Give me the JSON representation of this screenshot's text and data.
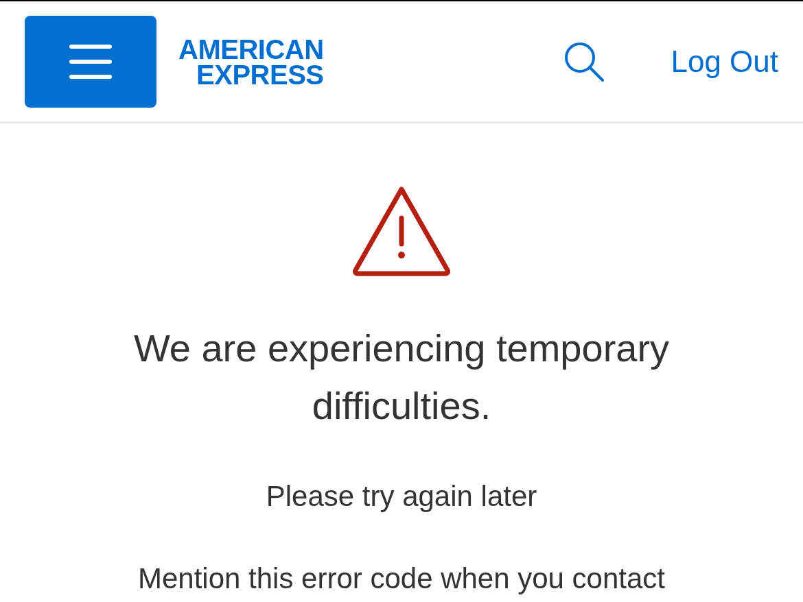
{
  "header": {
    "logo": [
      "AMERICAN",
      "EXPRESS"
    ],
    "log_out": "Log Out"
  },
  "error": {
    "heading": "We are experiencing temporary difficulties.",
    "message": "Please try again later",
    "note": "Mention this error code when you contact"
  }
}
